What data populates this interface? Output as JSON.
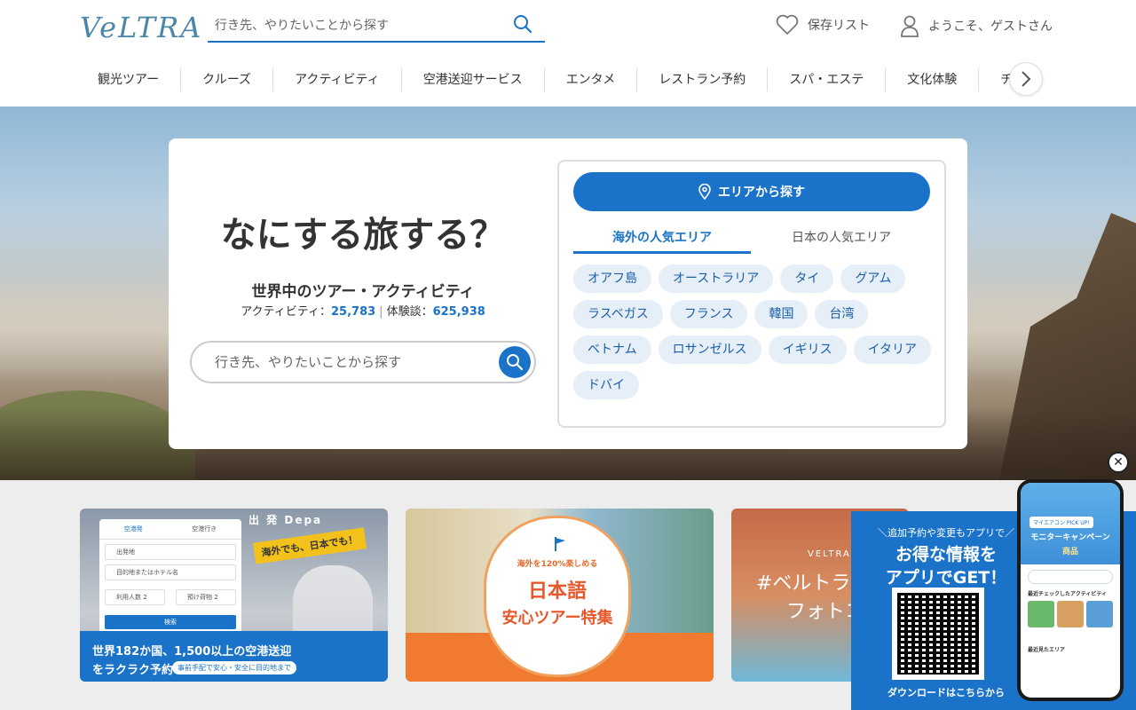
{
  "header": {
    "logo": "VeLTRA",
    "search_placeholder": "行き先、やりたいことから探す",
    "save_list": "保存リスト",
    "welcome": "ようこそ、ゲストさん"
  },
  "nav": {
    "items": [
      "観光ツアー",
      "クルーズ",
      "アクティビティ",
      "空港送迎サービス",
      "エンタメ",
      "レストラン予約",
      "スパ・エステ",
      "文化体験",
      "チケット"
    ]
  },
  "hero": {
    "title": "なにする旅する？",
    "subtitle": "世界中のツアー・アクティビティ",
    "activities_label": "アクティビティ：",
    "activities_count": "25,783",
    "reviews_label": "体験談：",
    "reviews_count": "625,938",
    "search_placeholder": "行き先、やりたいことから探す",
    "area_button": "エリアから探す",
    "tabs": [
      "海外の人気エリア",
      "日本の人気エリア"
    ],
    "areas": [
      "オアフ島",
      "オーストラリア",
      "タイ",
      "グアム",
      "ラスベガス",
      "フランス",
      "韓国",
      "台湾",
      "ベトナム",
      "ロサンゼルス",
      "イギリス",
      "イタリア",
      "ドバイ"
    ]
  },
  "banners": {
    "airport": {
      "station": "出 発 Depa",
      "tab_from": "空港発",
      "tab_to": "空港行き",
      "field_airport": "出発地",
      "field_dest": "目的地またはホテル名",
      "field_people": "利用人数 2",
      "field_luggage": "預け荷物 2",
      "button": "検索",
      "tag": "海外でも、日本でも！",
      "line1": "世界182か国、1,500以上の空港送迎",
      "line2": "をラクラク予約",
      "pill": "事前手配で安心・安全に目的地まで"
    },
    "japanese": {
      "small": "海外を120%楽しめる",
      "big": "日本語",
      "big2": "安心ツアー特集"
    },
    "photo": {
      "veltra": "VELTRA",
      "hash": "#ベルトラ",
      "photo": "フォトコ"
    }
  },
  "app_promo": {
    "t1": "＼追加予約や変更もアプリで／",
    "t2": "お得な情報を",
    "t3": "アプリでGET！",
    "download": "ダウンロードはこちらから",
    "phone_pick": "マイエアコン PICK UP!",
    "phone_campaign": "モニターキャンペーン",
    "phone_campaign2": "商品",
    "phone_label1": "最近チェックしたアクティビティ",
    "phone_label2": "最近見たエリア"
  },
  "colors": {
    "brand_blue": "#1a73c8",
    "chip_bg": "#e6eff8",
    "orange": "#f07a30"
  }
}
